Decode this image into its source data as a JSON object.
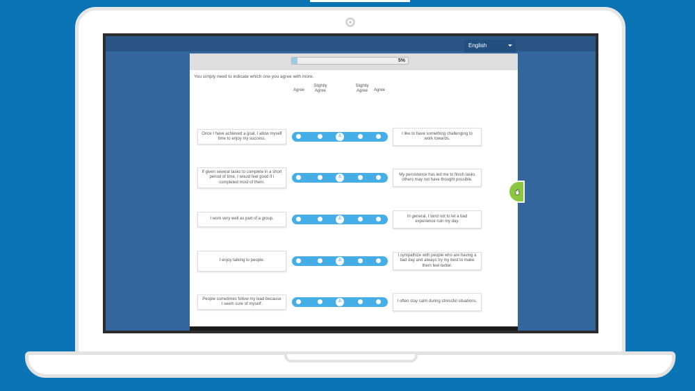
{
  "language": {
    "selected": "English"
  },
  "progress": {
    "percent": 5,
    "label": "5%"
  },
  "instruction": "You simply need to indicate which one you agree with more.",
  "scale": {
    "headers": [
      "Agree",
      "Slightly\nAgree",
      "",
      "Slightly\nAgree",
      "Agree"
    ],
    "center_symbol": "≙"
  },
  "items": [
    {
      "left": "Once I have achieved a goal, I allow myself time to enjoy my success.",
      "right": "I like to have something challenging to work towards."
    },
    {
      "left": "If given several tasks to complete in a short period of time, I would feel good if I completed most of them.",
      "right": "My persistence has led me to finish tasks others may not have thought possible."
    },
    {
      "left": "I work very well as part of a group.",
      "right": "In general, I tend not to let a bad experience ruin my day."
    },
    {
      "left": "I enjoy talking to people.",
      "right": "I sympathize with people who are having a bad day and always try my best to make them feel better."
    },
    {
      "left": "People sometimes follow my lead because I seem sure of myself.",
      "right": "I often stay calm during stressful situations."
    }
  ],
  "colors": {
    "slider": "#46aee6",
    "accent_tab": "#8cc63f",
    "background": "#0a74b5"
  }
}
